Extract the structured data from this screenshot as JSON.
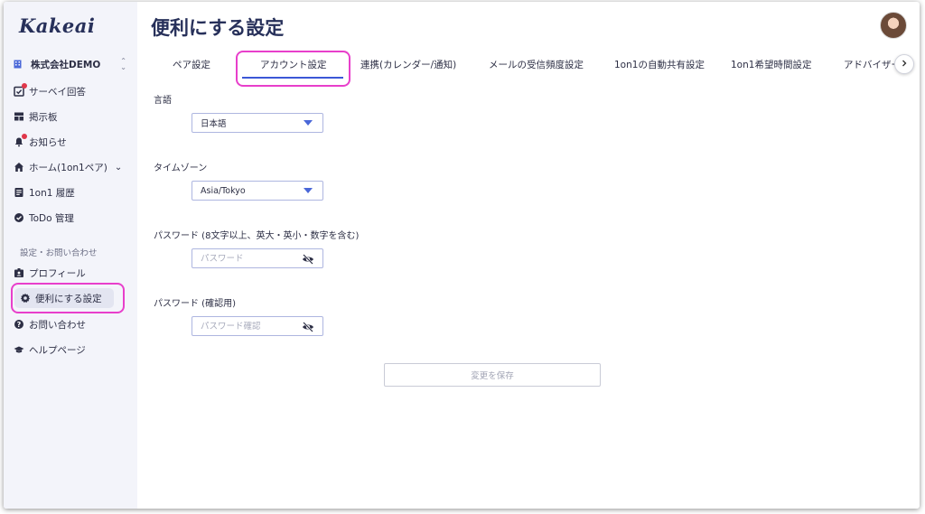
{
  "app": {
    "logo": "Kakeai",
    "page_title": "便利にする設定"
  },
  "sidebar": {
    "org": {
      "name": "株式会社DEMO",
      "toggle_top": "⌃",
      "toggle_bottom": "⌄"
    },
    "items": [
      {
        "label": "サーベイ回答",
        "icon": "clipboard-check-icon",
        "badge": true
      },
      {
        "label": "掲示板",
        "icon": "board-icon",
        "badge": false
      },
      {
        "label": "お知らせ",
        "icon": "bell-icon",
        "badge": true
      },
      {
        "label": "ホーム(1on1ペア)",
        "icon": "home-icon",
        "badge": false,
        "caret": "⌄"
      },
      {
        "label": "1on1 履歴",
        "icon": "history-icon",
        "badge": false
      },
      {
        "label": "ToDo 管理",
        "icon": "check-circle-icon",
        "badge": false
      }
    ],
    "section_label": "設定・お問い合わせ",
    "settings_items": [
      {
        "label": "プロフィール",
        "icon": "profile-icon"
      },
      {
        "label": "便利にする設定",
        "icon": "gear-icon",
        "active": true
      },
      {
        "label": "お問い合わせ",
        "icon": "question-icon"
      },
      {
        "label": "ヘルプページ",
        "icon": "graduation-cap-icon"
      }
    ]
  },
  "tabs": [
    {
      "label": "ペア設定"
    },
    {
      "label": "アカウント設定",
      "active": true
    },
    {
      "label": "連携(カレンダー/通知)"
    },
    {
      "label": "メールの受信頻度設定"
    },
    {
      "label": "1on1の自動共有設定"
    },
    {
      "label": "1on1希望時間設定"
    },
    {
      "label": "アドバイザー"
    }
  ],
  "form": {
    "language": {
      "label": "言語",
      "value": "日本語"
    },
    "timezone": {
      "label": "タイムゾーン",
      "value": "Asia/Tokyo"
    },
    "password": {
      "label": "パスワード (8文字以上、英大・英小・数字を含む)",
      "placeholder": "パスワード"
    },
    "password_confirm": {
      "label": "パスワード (確認用)",
      "placeholder": "パスワード確認"
    },
    "save_label": "変更を保存"
  },
  "colors": {
    "accent": "#3b57d6",
    "highlight": "#e83fcb",
    "badge": "#e0374a",
    "brand": "#27305a"
  }
}
